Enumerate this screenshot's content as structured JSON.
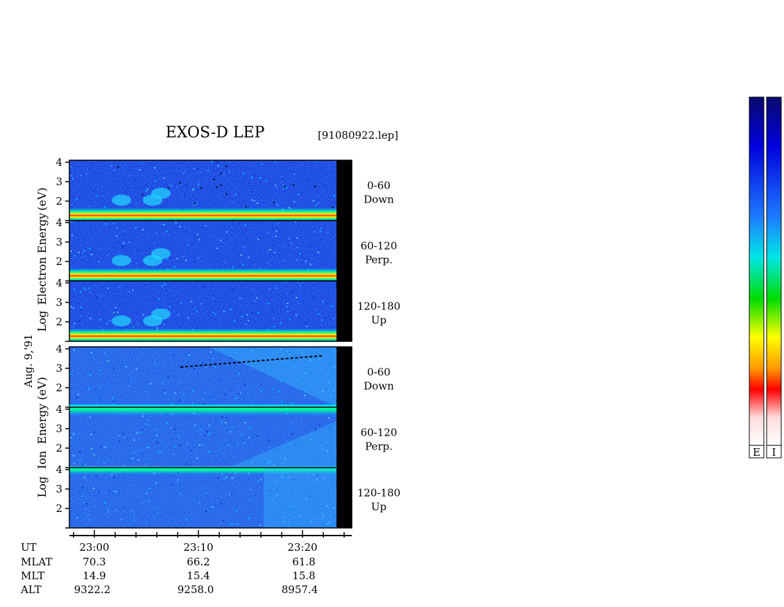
{
  "chart_data": {
    "type": "heatmap",
    "title": "EXOS-D LEP",
    "file_label": "[91080922.lep]",
    "date_label": "Aug. 9,'91",
    "panel_groups": [
      {
        "species": "Electron",
        "ylabel": "Log Electron Energy (eV)",
        "ylabel_parts": [
          "Log",
          "Electron",
          "Energy",
          "(eV)"
        ],
        "panels": [
          {
            "angle": "0-60",
            "direction": "Down",
            "ylim": [
              1,
              4.1
            ],
            "yticks": [
              "4",
              "3",
              "2"
            ]
          },
          {
            "angle": "60-120",
            "direction": "Perp.",
            "ylim": [
              1,
              4.1
            ],
            "yticks": [
              "4",
              "3",
              "2"
            ]
          },
          {
            "angle": "120-180",
            "direction": "Up",
            "ylim": [
              1,
              4.1
            ],
            "yticks": [
              "4",
              "3",
              "2"
            ]
          }
        ]
      },
      {
        "species": "Ion",
        "ylabel": "Log Ion Energy (eV)",
        "ylabel_parts": [
          "Log",
          "Ion",
          "Energy",
          "(eV)"
        ],
        "panels": [
          {
            "angle": "0-60",
            "direction": "Down",
            "ylim": [
              1,
              4.1
            ],
            "yticks": [
              "4",
              "3",
              "2"
            ]
          },
          {
            "angle": "60-120",
            "direction": "Perp.",
            "ylim": [
              1,
              4.1
            ],
            "yticks": [
              "4",
              "3",
              "2"
            ]
          },
          {
            "angle": "120-180",
            "direction": "Up",
            "ylim": [
              1,
              4.1
            ],
            "yticks": [
              "4",
              "3",
              "2"
            ]
          }
        ]
      }
    ],
    "x_axis": {
      "row_labels": [
        "UT",
        "MLAT",
        "MLT",
        "ALT"
      ],
      "columns": [
        {
          "UT": "23:00",
          "MLAT": "70.3",
          "MLT": "14.9",
          "ALT": "9322.2"
        },
        {
          "UT": "23:10",
          "MLAT": "66.2",
          "MLT": "15.4",
          "ALT": "9258.0"
        },
        {
          "UT": "23:20",
          "MLAT": "61.8",
          "MLT": "15.8",
          "ALT": "8957.4"
        }
      ]
    },
    "colorbars": [
      {
        "label": "E"
      },
      {
        "label": "I"
      }
    ],
    "colormap": [
      "#0a0a6e",
      "#0000dc",
      "#1e78ff",
      "#00e6e6",
      "#00dc00",
      "#ffff00",
      "#ff9600",
      "#ff0000",
      "#ffdcdc",
      "#ffffff"
    ]
  }
}
